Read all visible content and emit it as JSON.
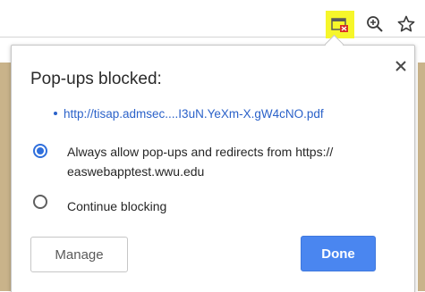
{
  "toolbar": {
    "popup_indicator_icon": "popup-blocked-icon",
    "zoom_icon": "zoom-icon",
    "bookmark_icon": "star-icon",
    "highlight_color": "#f6f62a"
  },
  "bubble": {
    "title": "Pop-ups blocked:",
    "close_icon": "close-icon",
    "blocked_url": "http://tisap.admsec....I3uN.YeXm-X.gW4cNO.pdf",
    "options": [
      {
        "label_line1": "Always allow pop-ups and redirects from https://",
        "label_line2": "easwebapptest.wwu.edu",
        "checked": true
      },
      {
        "label": "Continue blocking",
        "checked": false
      }
    ],
    "manage_label": "Manage",
    "done_label": "Done"
  },
  "colors": {
    "accent": "#4a86f0",
    "link": "#2b62c9",
    "radio_selected": "#2f6fdc"
  }
}
